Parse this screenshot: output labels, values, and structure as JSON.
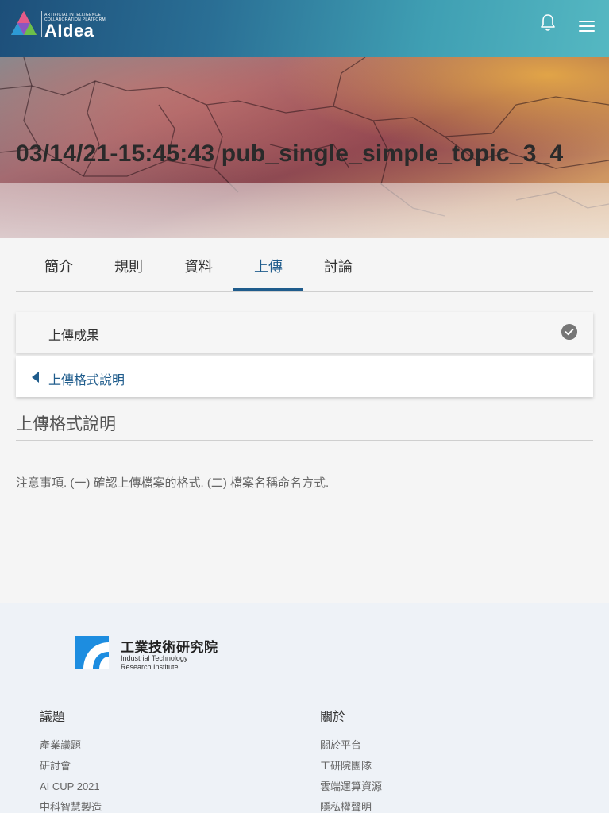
{
  "header": {
    "logo_tagline": [
      "ARTIFICIAL INTELLIGENCE",
      "COLLABORATION PLATFORM"
    ],
    "logo_text": "AIdea",
    "icons": [
      "bell-icon",
      "hamburger-menu-icon"
    ],
    "colors": {
      "bar_start": "#1d4f7a",
      "bar_end": "#55b8c2"
    }
  },
  "banner": {
    "title": "03/14/21-15:45:43 pub_single_simple_topic_3_4"
  },
  "tabs": [
    {
      "label": "簡介",
      "active": false
    },
    {
      "label": "規則",
      "active": false
    },
    {
      "label": "資料",
      "active": false
    },
    {
      "label": "上傳",
      "active": true
    },
    {
      "label": "討論",
      "active": false
    }
  ],
  "panels": {
    "upload_result": {
      "label": "上傳成果",
      "icon": "check-circle-icon"
    },
    "format_info": {
      "label": "上傳格式說明",
      "icon": "caret-left-icon"
    }
  },
  "section": {
    "title": "上傳格式說明",
    "text": "注意事項. (一) 確認上傳檔案的格式. (二) 檔案名稱命名方式."
  },
  "footer": {
    "org_name": "工業技術研究院",
    "org_en_line1": "Industrial Technology",
    "org_en_line2": "Research Institute",
    "columns": [
      {
        "title": "議題",
        "links": [
          "產業議題",
          "研討會",
          "AI CUP 2021",
          "中科智慧製造"
        ]
      },
      {
        "title": "關於",
        "links": [
          "關於平台",
          "工研院團隊",
          "雲端運算資源",
          "隱私權聲明"
        ]
      }
    ]
  },
  "accent_color": "#1f5c8c"
}
